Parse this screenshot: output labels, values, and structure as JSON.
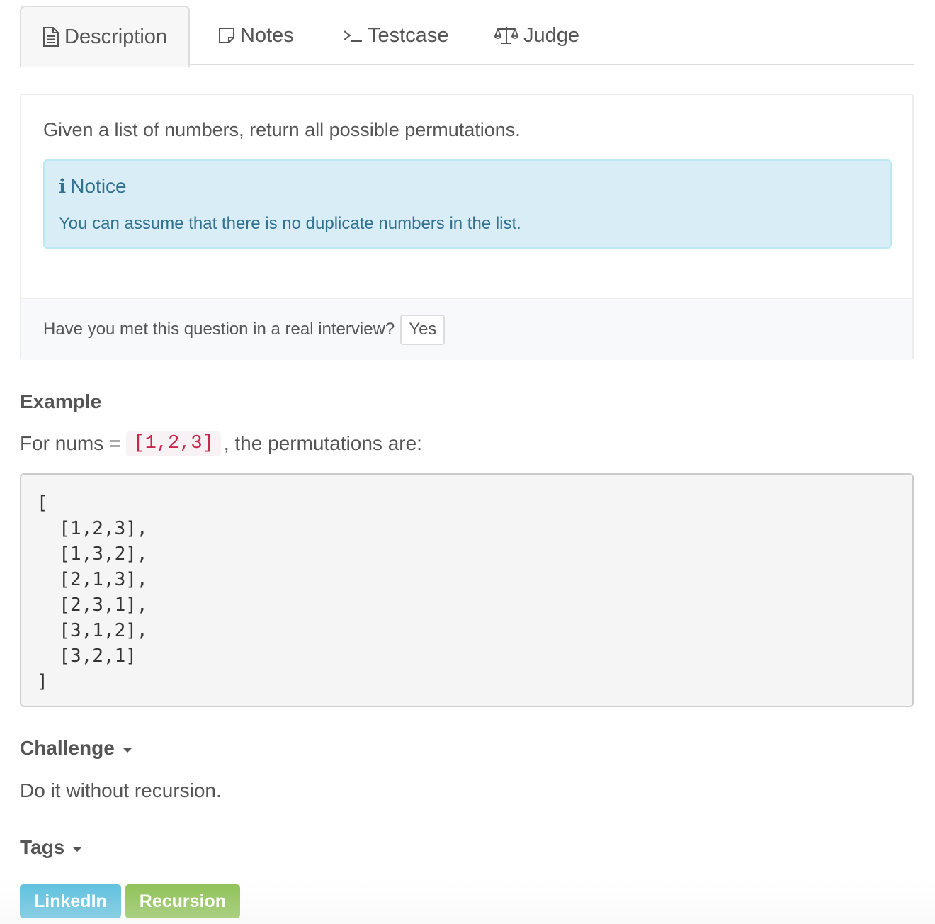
{
  "tabs": [
    {
      "label": "Description",
      "icon": "document-icon",
      "active": true
    },
    {
      "label": "Notes",
      "icon": "note-icon",
      "active": false
    },
    {
      "label": "Testcase",
      "icon": "terminal-icon",
      "active": false
    },
    {
      "label": "Judge",
      "icon": "scale-icon",
      "active": false
    }
  ],
  "problem": {
    "description": "Given a list of numbers, return all possible permutations.",
    "notice_title": "Notice",
    "notice_icon": "info-icon",
    "notice_text": "You can assume that there is no duplicate numbers in the list.",
    "interview_question": "Have you met this question in a real interview?",
    "yes_label": "Yes"
  },
  "example": {
    "heading": "Example",
    "prefix": "For nums =",
    "nums": "[1,2,3]",
    "suffix": ", the permutations are:",
    "output": "[\n  [1,2,3],\n  [1,3,2],\n  [2,1,3],\n  [2,3,1],\n  [3,1,2],\n  [3,2,1]\n]"
  },
  "challenge": {
    "heading": "Challenge",
    "text": "Do it without recursion."
  },
  "tags": {
    "heading": "Tags",
    "items": [
      {
        "label": "LinkedIn",
        "color": "#5bc0de"
      },
      {
        "label": "Recursion",
        "color": "#8cc152"
      }
    ]
  },
  "colors": {
    "notice_bg": "#d9edf7",
    "notice_text": "#31708f",
    "inline_code": "#c7254e"
  }
}
